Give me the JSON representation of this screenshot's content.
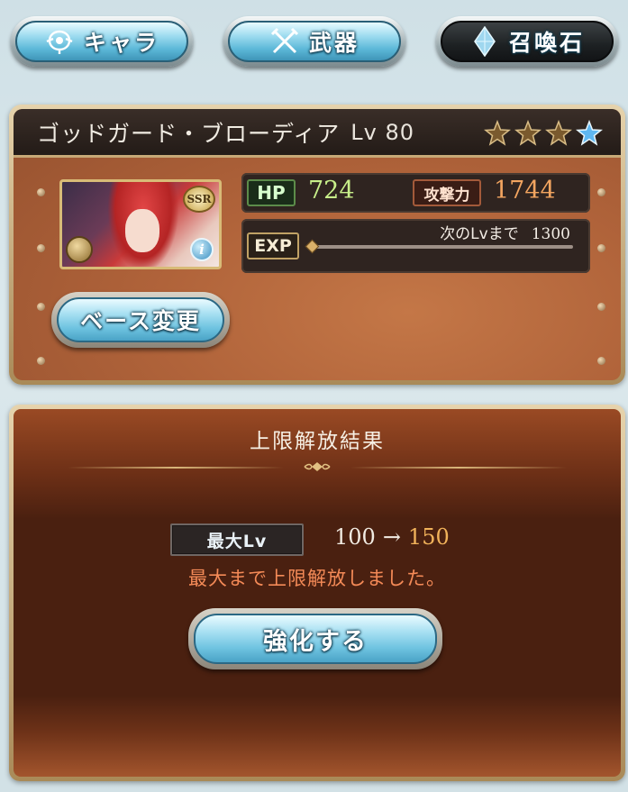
{
  "tabs": [
    {
      "label": "キャラ",
      "icon": "character-icon",
      "active": false
    },
    {
      "label": "武器",
      "icon": "weapon-icon",
      "active": false
    },
    {
      "label": "召喚石",
      "icon": "summon-stone-icon",
      "active": true
    }
  ],
  "character": {
    "name": "ゴッドガード・ブローディア",
    "level_label": "Lv",
    "level": "80",
    "stars": {
      "filled": 3,
      "blue": 1
    },
    "rarity": "SSR",
    "info_glyph": "i",
    "stats": {
      "hp_label": "HP",
      "hp": "724",
      "atk_label": "攻撃力",
      "atk": "1744",
      "exp_label": "EXP",
      "next_lv_label": "次のLvまで",
      "next_lv_exp": "1300",
      "exp_progress": 0
    },
    "base_change_button": "ベース変更"
  },
  "result": {
    "title": "上限解放結果",
    "max_lv_label": "最大Lv",
    "lv_from": "100",
    "arrow": "→",
    "lv_to": "150",
    "message": "最大まで上限解放しました。",
    "enhance_button": "強化する"
  },
  "colors": {
    "hp_value": "#c8ef8a",
    "atk_value": "#f3a560",
    "lv_to": "#f1b25a",
    "message": "#f48a57"
  }
}
